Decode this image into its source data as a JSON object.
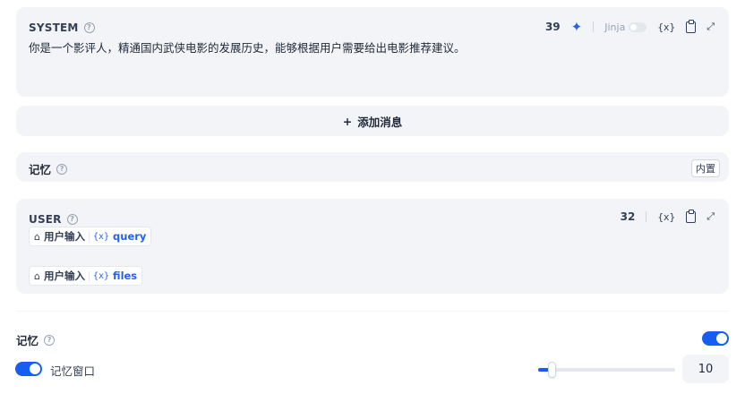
{
  "system": {
    "title": "SYSTEM",
    "help": "?",
    "text": "你是一个影评人，精通国内武侠电影的发展历史，能够根据用户需要给出电影推荐建议。",
    "count": "39",
    "sparkle": "✦",
    "jinja_label": "Jinja",
    "var_label": "{x}",
    "expand": "⤢"
  },
  "add_message": {
    "plus": "+",
    "label": "添加消息"
  },
  "memory_block": {
    "title": "记忆",
    "help": "?",
    "badge": "内置"
  },
  "user": {
    "title": "USER",
    "help": "?",
    "count": "32",
    "var_label": "{x}",
    "expand": "⤢",
    "tags": [
      {
        "home": "⌂",
        "label": "用户输入",
        "var": "{x}",
        "name": "query"
      },
      {
        "home": "⌂",
        "label": "用户输入",
        "var": "{x}",
        "name": "files"
      }
    ]
  },
  "memory_settings": {
    "title": "记忆",
    "help": "?",
    "enabled": true,
    "window_enabled": true,
    "window_label": "记忆窗口",
    "window_value": "10",
    "slider_fraction": 0.1
  },
  "colors": {
    "accent": "#155eef",
    "panel_bg": "#f2f4f7",
    "link": "#2563eb"
  }
}
